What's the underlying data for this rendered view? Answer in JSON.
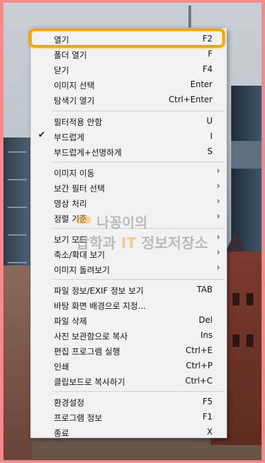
{
  "menu": {
    "items": [
      {
        "label": "열기",
        "shortcut": "F2"
      },
      {
        "label": "폴더 열기",
        "shortcut": "F"
      },
      {
        "label": "닫기",
        "shortcut": "F4"
      },
      {
        "label": "이미지 선택",
        "shortcut": "Enter"
      },
      {
        "label": "탐색기 열기",
        "shortcut": "Ctrl+Enter"
      },
      {
        "label": "필터적용 안함",
        "shortcut": "U"
      },
      {
        "label": "부드럽게",
        "shortcut": "I",
        "checked": true,
        "check_glyph": "✔"
      },
      {
        "label": "부드럽게+선명하게",
        "shortcut": "S"
      },
      {
        "label": "이미지 이동",
        "submenu_glyph": "›"
      },
      {
        "label": "보간 필터 선택",
        "submenu_glyph": "›"
      },
      {
        "label": "영상 처리",
        "submenu_glyph": "›"
      },
      {
        "label": "정렬 기준",
        "submenu_glyph": "›"
      },
      {
        "label": "보기 모드",
        "submenu_glyph": "›"
      },
      {
        "label": "축소/확대 보기",
        "submenu_glyph": "›"
      },
      {
        "label": "이미지 돌려보기",
        "submenu_glyph": "›"
      },
      {
        "label": "파일 정보/EXIF 정보 보기",
        "shortcut": "TAB"
      },
      {
        "label": "바탕 화면 배경으로 지정...",
        "shortcut": ""
      },
      {
        "label": "파일 삭제",
        "shortcut": "Del"
      },
      {
        "label": "사진 보관함으로 복사",
        "shortcut": "Ins"
      },
      {
        "label": "편집 프로그램 실행",
        "shortcut": "Ctrl+E"
      },
      {
        "label": "인쇄",
        "shortcut": "Ctrl+P"
      },
      {
        "label": "클립보드로 복사하기",
        "shortcut": "Ctrl+C"
      },
      {
        "label": "환경설정",
        "shortcut": "F5"
      },
      {
        "label": "프로그램 정보",
        "shortcut": "F1"
      },
      {
        "label": "종료",
        "shortcut": "X"
      }
    ]
  },
  "watermark": {
    "line1": "나꽁이의",
    "line2_prefix": "잡학과 ",
    "line2_it": "IT",
    "line2_suffix": " 정보저장소"
  },
  "colors": {
    "highlight": "#f7a800",
    "border": "#f28b8b"
  }
}
